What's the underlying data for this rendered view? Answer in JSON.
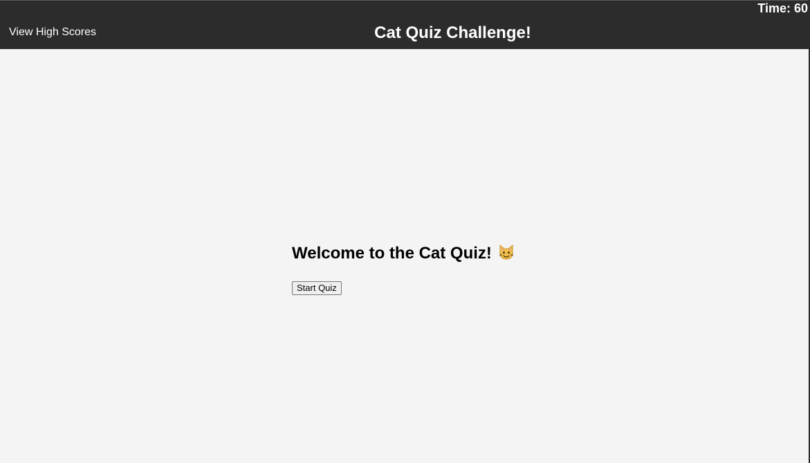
{
  "header": {
    "high_scores_label": "View High Scores",
    "title": "Cat Quiz Challenge!",
    "timer_text": "Time: 60"
  },
  "main": {
    "welcome_heading": "Welcome to the Cat Quiz!",
    "welcome_icon": "smiling-cat-face-icon",
    "start_button_label": "Start Quiz"
  },
  "colors": {
    "header_background": "#2c2c2c",
    "page_background": "#f4f4f4",
    "header_text": "#ffffff",
    "body_text": "#000000"
  }
}
